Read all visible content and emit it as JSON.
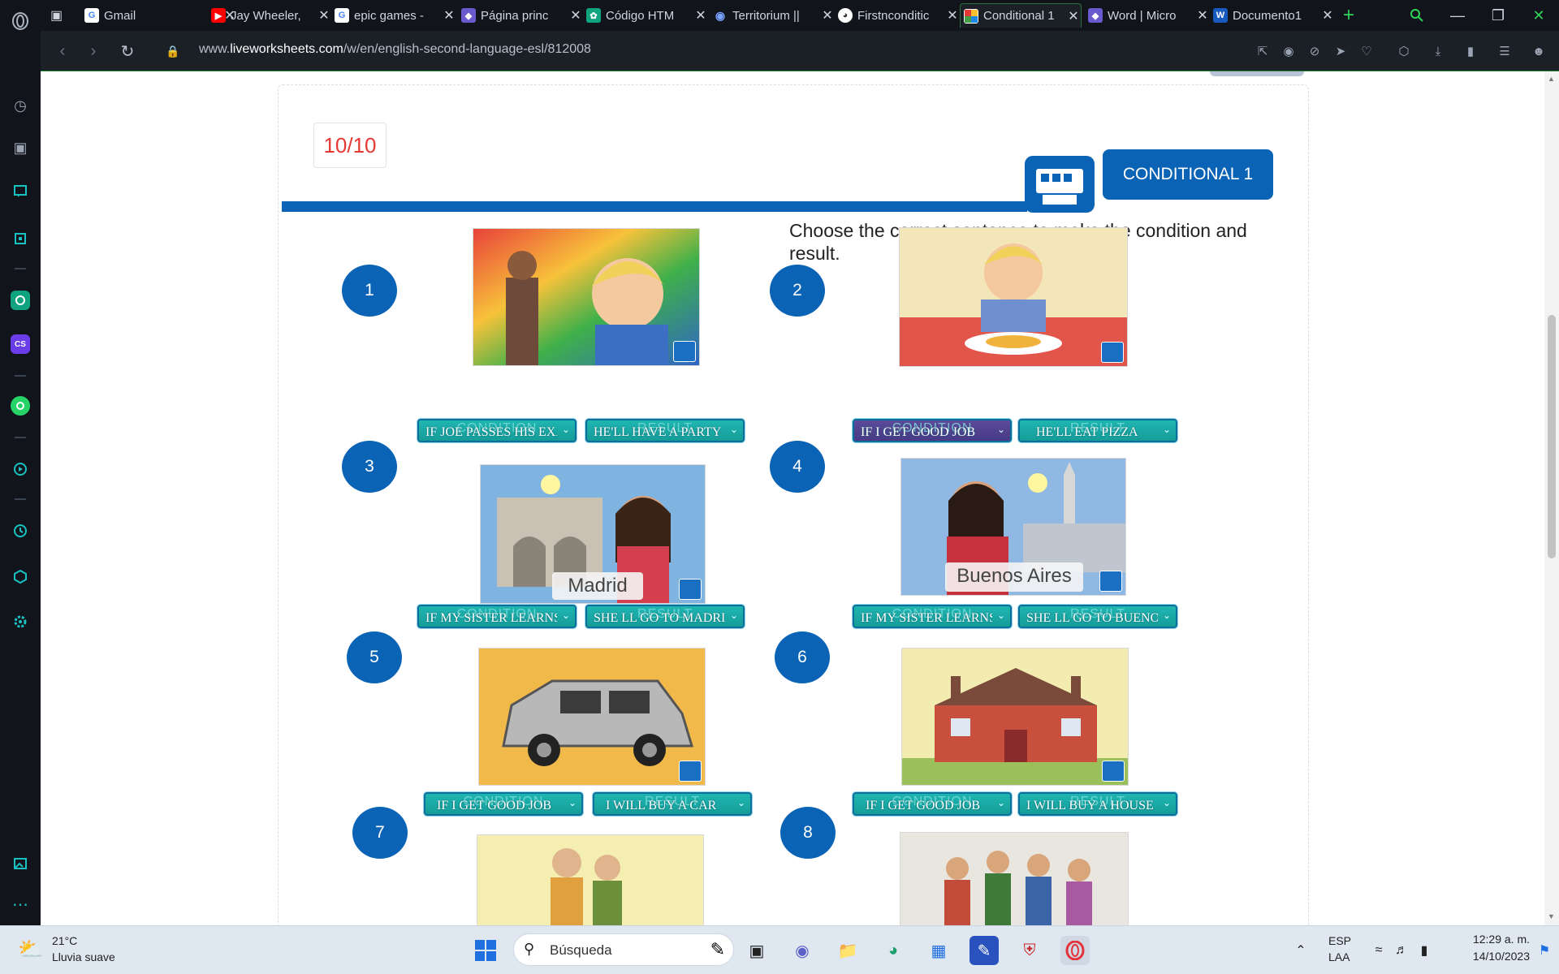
{
  "browser": {
    "tabs": [
      {
        "title": "Gmail",
        "icon": "google-icon",
        "color": "#ffffff"
      },
      {
        "title": "Jay Wheeler,",
        "icon": "youtube-icon",
        "color": "#ff0000"
      },
      {
        "title": "epic games -",
        "icon": "google-icon",
        "color": "#ffffff"
      },
      {
        "title": "Página princ",
        "icon": "bookmark-icon",
        "color": "#6a5acd"
      },
      {
        "title": "Código HTM",
        "icon": "chatgpt-icon",
        "color": "#10a37f"
      },
      {
        "title": "Territorium ||",
        "icon": "eye-icon",
        "color": "#7aa2ff"
      },
      {
        "title": "Firstnconditic",
        "icon": "globe-icon",
        "color": "#ffffff"
      },
      {
        "title": "Conditional 1",
        "icon": "liveworksheets-icon",
        "color": "#e53935"
      },
      {
        "title": "Word | Micro",
        "icon": "bookmark-icon",
        "color": "#6a5acd"
      },
      {
        "title": "Documento1",
        "icon": "word-icon",
        "color": "#185abd"
      }
    ],
    "url_prefix": "www.",
    "url_domain": "liveworksheets.com",
    "url_path": "/w/en/english-second-language-esl/812008"
  },
  "worksheet": {
    "score": "10/10",
    "title": "CONDITIONAL 1",
    "instruction": "Choose the correct sentence to make the condition and result.",
    "ghost_condition": "CONDITION",
    "ghost_result": "RESULT",
    "items": [
      {
        "number": "1",
        "condition": "IF JOE PASSES HIS EXAM",
        "result": "HE'LL HAVE A PARTY"
      },
      {
        "number": "2",
        "condition": "IF I GET GOOD JOB",
        "result": "HE'LL EAT PIZZA"
      },
      {
        "number": "3",
        "condition": "IF MY SISTER LEARNS SPANISH",
        "result": "SHE LL GO TO MADRID"
      },
      {
        "number": "4",
        "condition": "IF MY SISTER LEARNS SPANISH",
        "result": "SHE LL GO TO BUENOS AIRES"
      },
      {
        "number": "5",
        "condition": "IF I GET GOOD JOB",
        "result": "I WILL BUY A CAR"
      },
      {
        "number": "6",
        "condition": "IF I GET GOOD JOB",
        "result": "I WILL BUY A HOUSE"
      },
      {
        "number": "7"
      },
      {
        "number": "8"
      }
    ],
    "picture_captions": {
      "madrid": "Madrid",
      "buenos_aires": "Buenos Aires"
    }
  },
  "taskbar": {
    "weather_temp": "21°C",
    "weather_desc": "Lluvia suave",
    "search_placeholder": "Búsqueda",
    "lang_line1": "ESP",
    "lang_line2": "LAA",
    "time": "12:29 a. m.",
    "date": "14/10/2023"
  },
  "colors": {
    "accent": "#0b63b5",
    "select": "#1fb6b2",
    "browser_dark": "#11141a",
    "score": "#e53935"
  }
}
